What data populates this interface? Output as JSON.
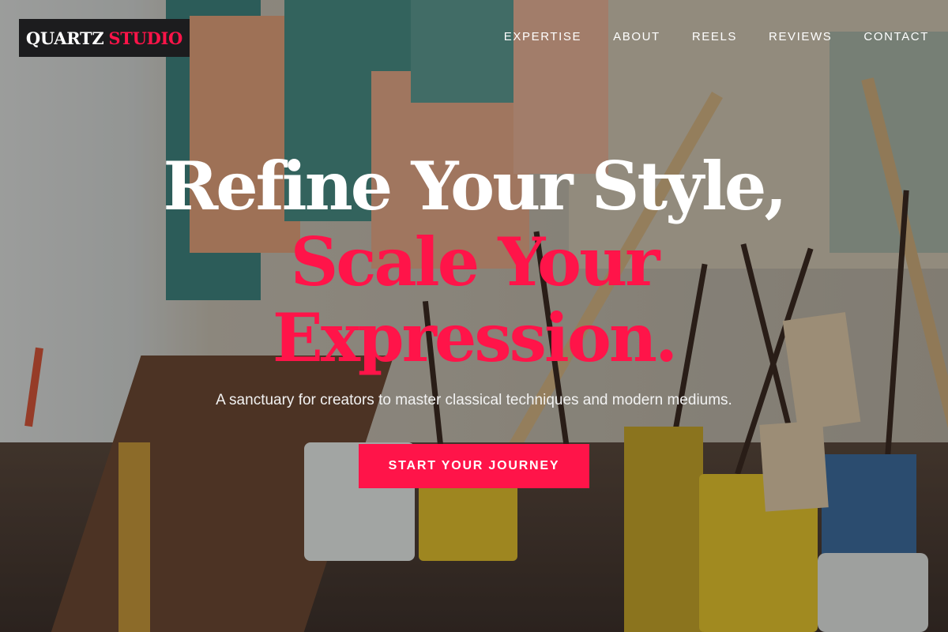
{
  "brand": {
    "name_primary": "QUARTZ",
    "name_accent": "STUDIO"
  },
  "nav": {
    "items": [
      {
        "label": "EXPERTISE"
      },
      {
        "label": "ABOUT"
      },
      {
        "label": "REELS"
      },
      {
        "label": "REVIEWS"
      },
      {
        "label": "CONTACT"
      }
    ]
  },
  "hero": {
    "headline_line1": "Refine Your Style,",
    "headline_line2": "Scale Your",
    "headline_line3": "Expression.",
    "subtitle": "A sanctuary for creators to master classical techniques and modern mediums.",
    "cta_label": "START YOUR JOURNEY"
  },
  "colors": {
    "accent": "#ff1449",
    "logo_background": "#1c1c1e",
    "text_light": "#ffffff"
  }
}
